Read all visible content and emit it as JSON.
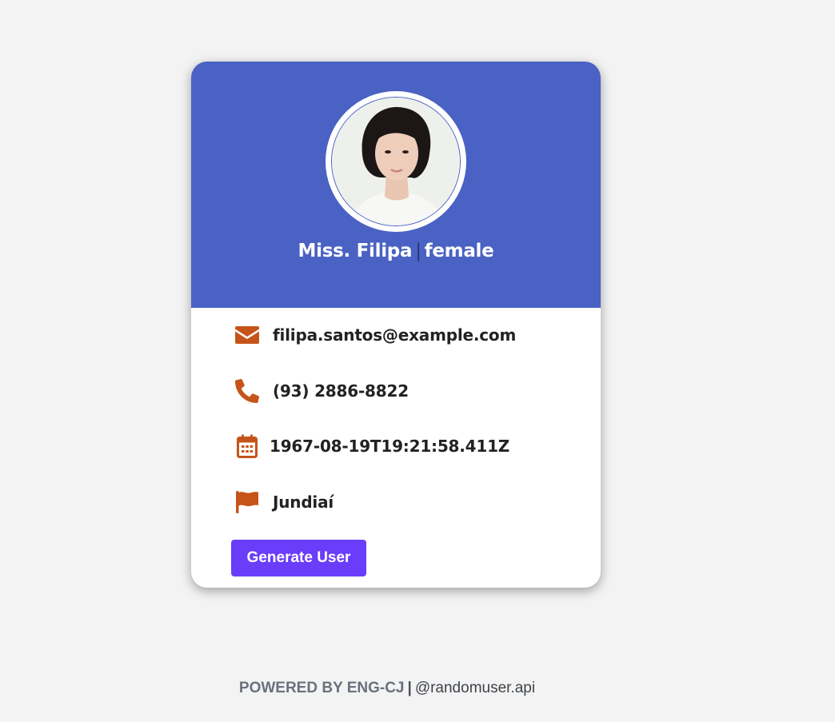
{
  "card": {
    "title": "Miss. Filipa",
    "separator": "|",
    "gender": "female",
    "avatar_alt": "profile photo",
    "header_color": "#4a62c3"
  },
  "details": [
    {
      "icon": "envelope-icon",
      "value": "filipa.santos@example.com"
    },
    {
      "icon": "phone-icon",
      "value": "(93) 2886-8822"
    },
    {
      "icon": "calendar-icon",
      "value": "1967-08-19T19:21:58.411Z"
    },
    {
      "icon": "flag-icon",
      "value": "Jundiaí"
    }
  ],
  "actions": {
    "generate_label": "Generate User",
    "button_color": "#6a3dfa"
  },
  "footer": {
    "powered_by": "POWERED BY ENG-CJ",
    "separator": "|",
    "handle": "@randomuser.api"
  },
  "colors": {
    "icon_accent": "#c6541a",
    "page_background": "#f3f3f3"
  }
}
